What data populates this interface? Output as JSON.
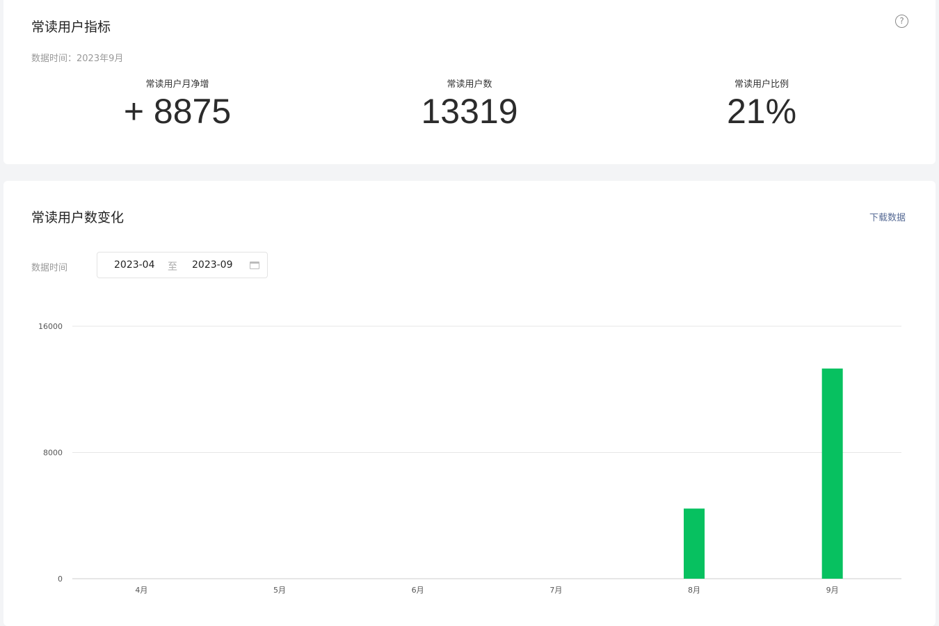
{
  "summary": {
    "title": "常读用户指标",
    "data_time": "数据时间：2023年9月",
    "help_icon": "?",
    "metrics": [
      {
        "label": "常读用户月净增",
        "value": "+ 8875"
      },
      {
        "label": "常读用户数",
        "value": "13319"
      },
      {
        "label": "常读用户比例",
        "value": "21%"
      }
    ]
  },
  "trend": {
    "title": "常读用户数变化",
    "download": "下载数据",
    "date_label": "数据时间",
    "start": "2023-04",
    "sep": "至",
    "end": "2023-09"
  },
  "chart_data": {
    "type": "bar",
    "title": "常读用户数变化",
    "categories": [
      "4月",
      "5月",
      "6月",
      "7月",
      "8月",
      "9月"
    ],
    "values": [
      0,
      0,
      0,
      0,
      4444,
      13319
    ],
    "ylim": [
      0,
      16000
    ],
    "yticks": [
      "0",
      "8000",
      "16000"
    ],
    "color": "#07c160",
    "grid": true
  }
}
